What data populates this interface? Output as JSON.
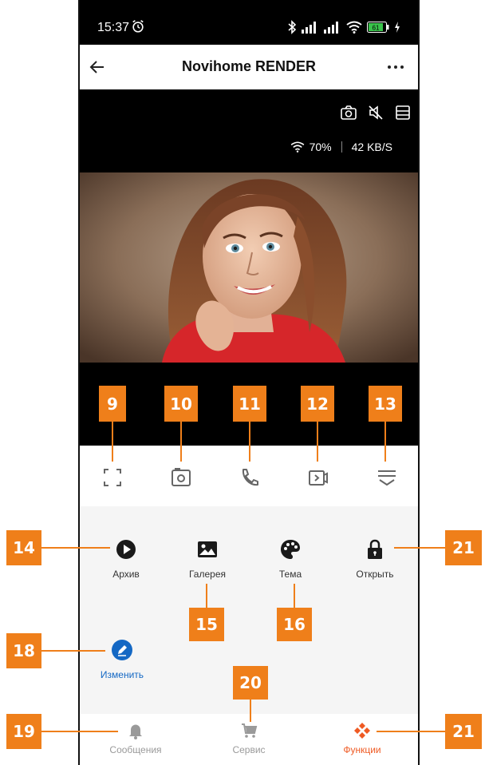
{
  "statusbar": {
    "time": "15:37",
    "battery": "61"
  },
  "header": {
    "title": "Novihome RENDER"
  },
  "video": {
    "signal": "70%",
    "bitrate": "42 KB/S"
  },
  "controls": [
    {
      "name": "fullscreen",
      "callout": "9"
    },
    {
      "name": "snapshot",
      "callout": "10"
    },
    {
      "name": "call",
      "callout": "11"
    },
    {
      "name": "record",
      "callout": "12"
    },
    {
      "name": "more-options",
      "callout": "13"
    }
  ],
  "features": [
    {
      "label": "Архив",
      "icon": "play-icon",
      "callout": "14"
    },
    {
      "label": "Галерея",
      "icon": "image-icon",
      "callout": "15"
    },
    {
      "label": "Тема",
      "icon": "palette-icon",
      "callout": "16"
    },
    {
      "label": "Открыть",
      "icon": "lock-icon",
      "callout": "21"
    },
    {
      "label": "Изменить",
      "icon": "edit-icon",
      "callout": "18"
    }
  ],
  "nav": [
    {
      "label": "Сообщения",
      "icon": "bell-icon",
      "callout": "19"
    },
    {
      "label": "Сервис",
      "icon": "cart-icon",
      "callout": "20"
    },
    {
      "label": "Функции",
      "icon": "functions-icon",
      "callout": "21",
      "active": true
    }
  ],
  "colors": {
    "accent": "#ef5a23",
    "callout": "#ef7f1a",
    "edit": "#1468c4"
  }
}
